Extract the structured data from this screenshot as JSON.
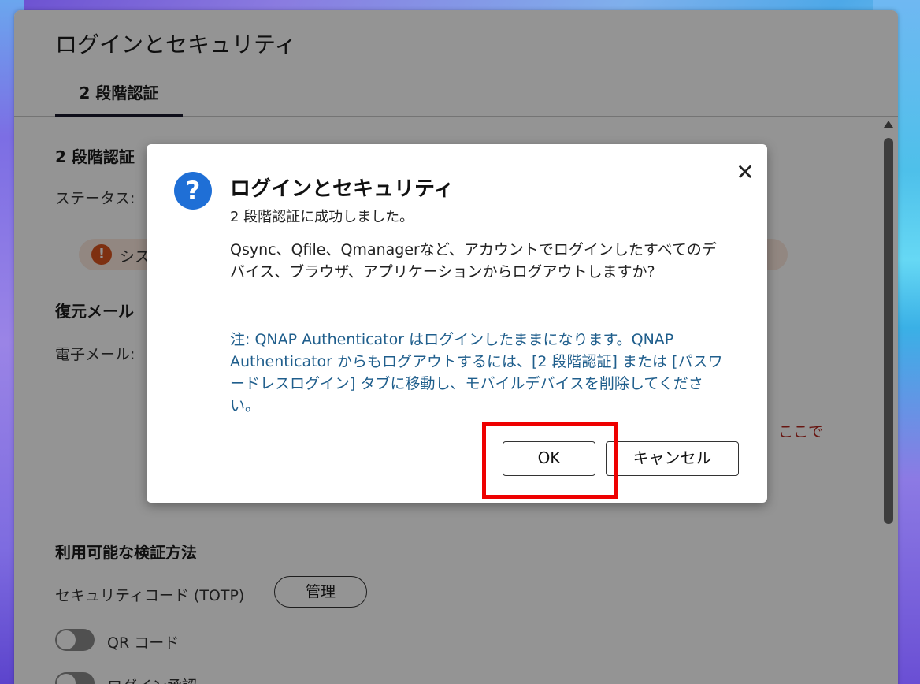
{
  "window": {
    "title": "ログインとセキュリティ",
    "tab": "2 段階認証"
  },
  "content": {
    "section_2fa": "2 段階認証",
    "status_label": "ステータス:",
    "alert_text": "シス",
    "recovery_title": "復元メール",
    "email_label": "電子メール:",
    "link_here": "ここで",
    "methods_title": "利用可能な検証方法",
    "totp_label": "セキュリティコード (TOTP)",
    "manage_button": "管理",
    "qr_label": "QR コード",
    "login_approval_label": "ログイン承認"
  },
  "dialog": {
    "title": "ログインとセキュリティ",
    "subtitle": "2 段階認証に成功しました。",
    "message": "Qsync、Qfile、Qmanagerなど、アカウントでログインしたすべてのデバイス、ブラウザ、アプリケーションからログアウトしますか?",
    "note": "注: QNAP Authenticator はログインしたままになります。QNAP Authenticator からもログアウトするには、[2 段階認証] または [パスワードレスログイン] タブに移動し、モバイルデバイスを削除してください。",
    "ok_button": "OK",
    "cancel_button": "キャンセル"
  },
  "icons": {
    "question": "question-circle-icon",
    "close": "close-icon",
    "alert": "exclamation-circle-icon"
  },
  "colors": {
    "accent_blue": "#1f6fd6",
    "note_text": "#1f5e8c",
    "alert_orange": "#d9531e",
    "highlight_red": "#ee0000"
  }
}
